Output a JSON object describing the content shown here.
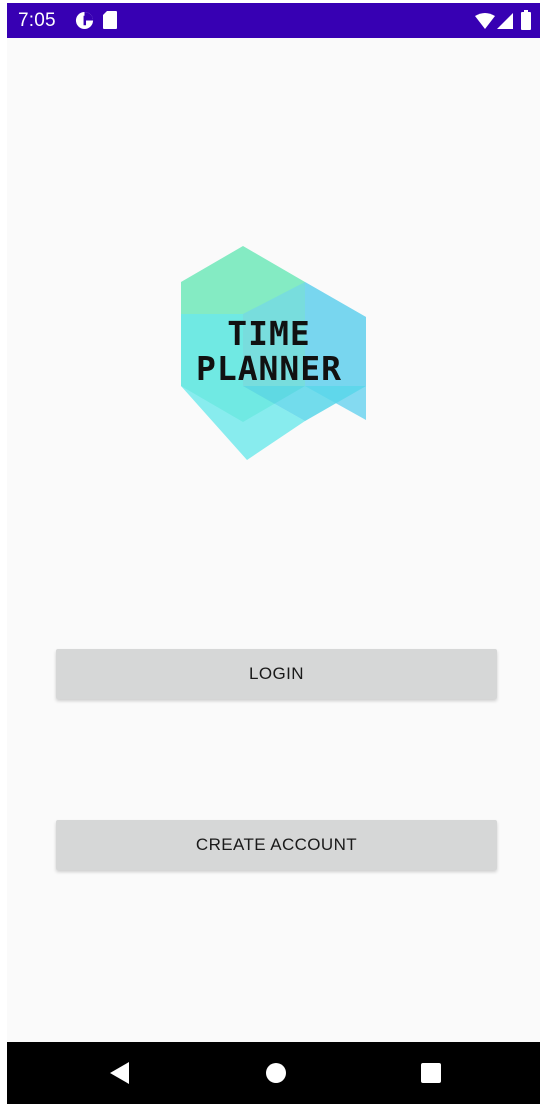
{
  "status_bar": {
    "time": "7:05",
    "background_color": "#3700b3",
    "left_icons": [
      "data-saver-icon",
      "sd-card-icon"
    ],
    "right_icons": [
      "wifi-icon",
      "cell-signal-icon",
      "battery-icon"
    ]
  },
  "logo": {
    "line1": "TIME",
    "line2": "PLANNER",
    "colors": {
      "green": "#6fe8b8",
      "blue": "#6fd3ef",
      "cyan": "#6ce9eb"
    }
  },
  "buttons": {
    "login_label": "LOGIN",
    "create_account_label": "CREATE ACCOUNT",
    "background_color": "#d6d7d7"
  },
  "nav_bar": {
    "items": [
      "back-icon",
      "home-icon",
      "recents-icon"
    ]
  }
}
